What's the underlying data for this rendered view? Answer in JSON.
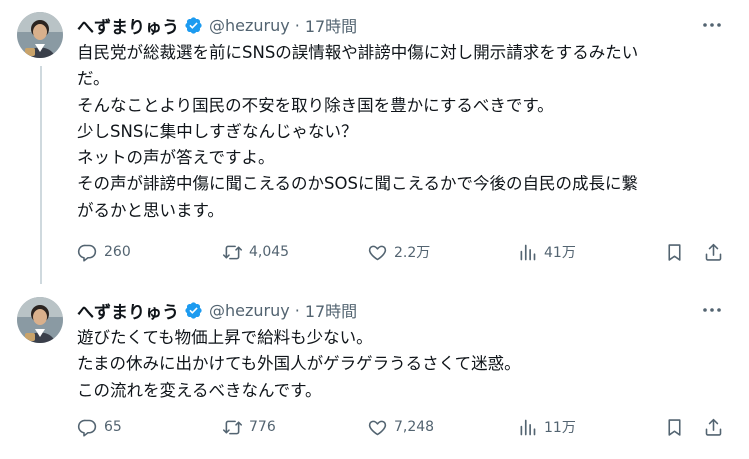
{
  "tweets": [
    {
      "display_name": "へずまりゅう",
      "handle": "@hezuruy",
      "separator": "·",
      "time": "17時間",
      "text_lines": [
        "自民党が総裁選を前にSNSの誤情報や誹謗中傷に対し開示請求をするみたい",
        "だ。",
        "そんなことより国民の不安を取り除き国を豊かにするべきです。",
        "少しSNSに集中しすぎなんじゃない？",
        "ネットの声が答えですよ。",
        "その声が誹謗中傷に聞こえるのかSOSに聞こえるかで今後の自民の成長に繋",
        "がるかと思います。"
      ],
      "replies": "260",
      "retweets": "4,045",
      "likes": "2.2万",
      "views": "41万"
    },
    {
      "display_name": "へずまりゅう",
      "handle": "@hezuruy",
      "separator": "·",
      "time": "17時間",
      "text_lines": [
        "遊びたくても物価上昇で給料も少ない。",
        "たまの休みに出かけても外国人がゲラゲラうるさくて迷惑。",
        "この流れを変えるべきなんです。"
      ],
      "replies": "65",
      "retweets": "776",
      "likes": "7,248",
      "views": "11万"
    }
  ],
  "icons": {
    "verified": "verified-badge-icon",
    "more": "more-icon",
    "reply": "reply-icon",
    "retweet": "retweet-icon",
    "like": "like-icon",
    "views": "views-icon",
    "bookmark": "bookmark-icon",
    "share": "share-icon"
  },
  "colors": {
    "text": "#0f1419",
    "secondary": "#536471",
    "verified": "#1d9bf0",
    "thread_line": "#cfd9de"
  }
}
